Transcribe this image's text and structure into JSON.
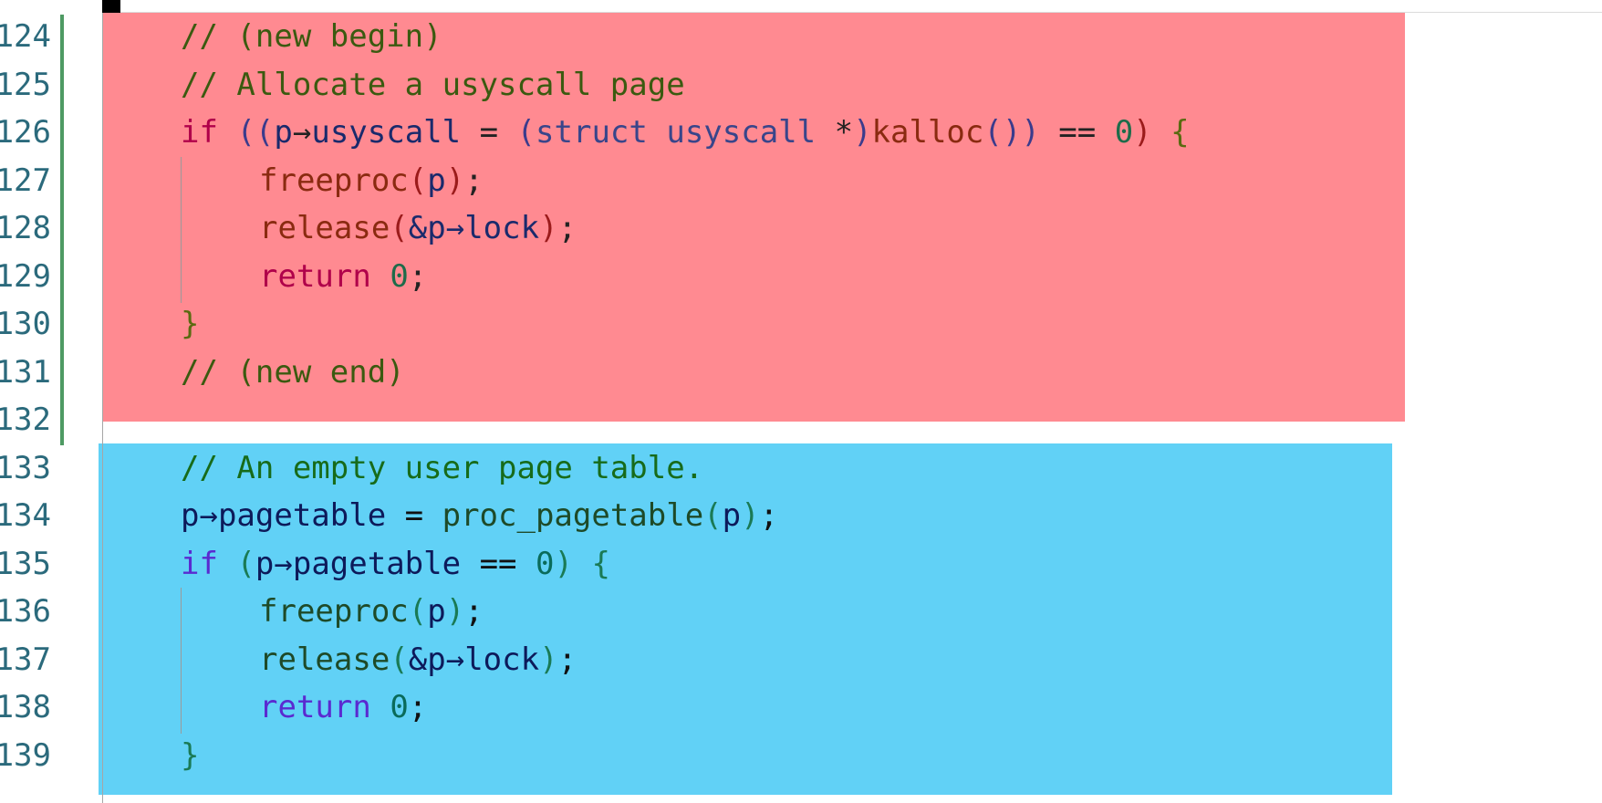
{
  "editor": {
    "colors": {
      "added_block": "#ff8a91",
      "context_block": "#61d1f6",
      "change_bar": "#4e9a63",
      "line_number": "#2b6a7c"
    },
    "lines": [
      {
        "number": "124",
        "block": "added",
        "indent": 1,
        "tokens": [
          {
            "t": "// (new begin)",
            "k": "cmt"
          }
        ]
      },
      {
        "number": "125",
        "block": "added",
        "indent": 1,
        "tokens": [
          {
            "t": "// Allocate a usyscall page",
            "k": "cmt"
          }
        ]
      },
      {
        "number": "126",
        "block": "added",
        "indent": 1,
        "tokens": [
          {
            "t": "if",
            "k": "kw"
          },
          {
            "t": " ",
            "k": "op"
          },
          {
            "t": "((",
            "k": "br1"
          },
          {
            "t": "p",
            "k": "id"
          },
          {
            "t": "→",
            "k": "op"
          },
          {
            "t": "usyscall",
            "k": "id"
          },
          {
            "t": " = ",
            "k": "op"
          },
          {
            "t": "(",
            "k": "br1"
          },
          {
            "t": "struct",
            "k": "ty"
          },
          {
            "t": " ",
            "k": "op"
          },
          {
            "t": "usyscall",
            "k": "ty"
          },
          {
            "t": " *",
            "k": "op"
          },
          {
            "t": ")",
            "k": "br1"
          },
          {
            "t": "kalloc",
            "k": "fn"
          },
          {
            "t": "())",
            "k": "br1"
          },
          {
            "t": " == ",
            "k": "op"
          },
          {
            "t": "0",
            "k": "num"
          },
          {
            "t": ")",
            "k": "br2"
          },
          {
            "t": " ",
            "k": "op"
          },
          {
            "t": "{",
            "k": "br3"
          }
        ]
      },
      {
        "number": "127",
        "block": "added",
        "indent": 2,
        "tokens": [
          {
            "t": "freeproc",
            "k": "fn"
          },
          {
            "t": "(",
            "k": "br2"
          },
          {
            "t": "p",
            "k": "id"
          },
          {
            "t": ")",
            "k": "br2"
          },
          {
            "t": ";",
            "k": "op"
          }
        ]
      },
      {
        "number": "128",
        "block": "added",
        "indent": 2,
        "tokens": [
          {
            "t": "release",
            "k": "fn"
          },
          {
            "t": "(",
            "k": "br2"
          },
          {
            "t": "&p→lock",
            "k": "id"
          },
          {
            "t": ")",
            "k": "br2"
          },
          {
            "t": ";",
            "k": "op"
          }
        ]
      },
      {
        "number": "129",
        "block": "added",
        "indent": 2,
        "tokens": [
          {
            "t": "return",
            "k": "kw"
          },
          {
            "t": " ",
            "k": "op"
          },
          {
            "t": "0",
            "k": "num"
          },
          {
            "t": ";",
            "k": "op"
          }
        ]
      },
      {
        "number": "130",
        "block": "added",
        "indent": 1,
        "tokens": [
          {
            "t": "}",
            "k": "br3"
          }
        ]
      },
      {
        "number": "131",
        "block": "added",
        "indent": 1,
        "tokens": [
          {
            "t": "// (new end)",
            "k": "cmt"
          }
        ]
      },
      {
        "number": "132",
        "block": "added",
        "indent": 0,
        "tokens": []
      },
      {
        "number": "133",
        "block": "context",
        "indent": 1,
        "tokens": [
          {
            "t": "// An empty user page table.",
            "k": "cmt"
          }
        ]
      },
      {
        "number": "134",
        "block": "context",
        "indent": 1,
        "tokens": [
          {
            "t": "p→pagetable",
            "k": "id"
          },
          {
            "t": " = ",
            "k": "op"
          },
          {
            "t": "proc_pagetable",
            "k": "fn"
          },
          {
            "t": "(",
            "k": "br"
          },
          {
            "t": "p",
            "k": "id"
          },
          {
            "t": ")",
            "k": "br"
          },
          {
            "t": ";",
            "k": "op"
          }
        ]
      },
      {
        "number": "135",
        "block": "context",
        "indent": 1,
        "tokens": [
          {
            "t": "if",
            "k": "kw"
          },
          {
            "t": " ",
            "k": "op"
          },
          {
            "t": "(",
            "k": "br"
          },
          {
            "t": "p→pagetable",
            "k": "id"
          },
          {
            "t": " == ",
            "k": "op"
          },
          {
            "t": "0",
            "k": "num"
          },
          {
            "t": ")",
            "k": "br"
          },
          {
            "t": " ",
            "k": "op"
          },
          {
            "t": "{",
            "k": "br"
          }
        ]
      },
      {
        "number": "136",
        "block": "context",
        "indent": 2,
        "tokens": [
          {
            "t": "freeproc",
            "k": "fn"
          },
          {
            "t": "(",
            "k": "br"
          },
          {
            "t": "p",
            "k": "id"
          },
          {
            "t": ")",
            "k": "br"
          },
          {
            "t": ";",
            "k": "op"
          }
        ]
      },
      {
        "number": "137",
        "block": "context",
        "indent": 2,
        "tokens": [
          {
            "t": "release",
            "k": "fn"
          },
          {
            "t": "(",
            "k": "br"
          },
          {
            "t": "&p→lock",
            "k": "id"
          },
          {
            "t": ")",
            "k": "br"
          },
          {
            "t": ";",
            "k": "op"
          }
        ]
      },
      {
        "number": "138",
        "block": "context",
        "indent": 2,
        "tokens": [
          {
            "t": "return",
            "k": "kw"
          },
          {
            "t": " ",
            "k": "op"
          },
          {
            "t": "0",
            "k": "num"
          },
          {
            "t": ";",
            "k": "op"
          }
        ]
      },
      {
        "number": "139",
        "block": "context",
        "indent": 1,
        "tokens": [
          {
            "t": "}",
            "k": "br"
          }
        ]
      }
    ]
  }
}
